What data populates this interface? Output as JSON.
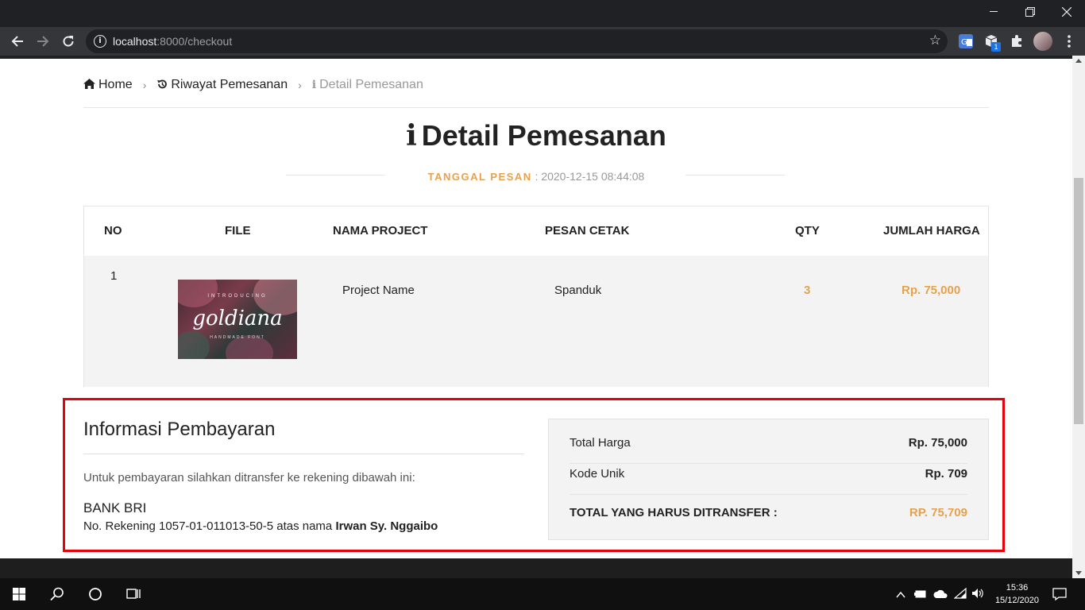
{
  "browser": {
    "url_host": "localhost",
    "url_path": ":8000/checkout",
    "extension_badge": "1"
  },
  "breadcrumb": {
    "home": "Home",
    "history": "Riwayat Pemesanan",
    "current": "Detail Pemesanan"
  },
  "page": {
    "title": "Detail Pemesanan",
    "date_label": "TANGGAL PESAN",
    "date_value": " : 2020-12-15 08:44:08"
  },
  "table": {
    "headers": [
      "NO",
      "FILE",
      "NAMA PROJECT",
      "PESAN CETAK",
      "QTY",
      "JUMLAH HARGA"
    ],
    "rows": [
      {
        "no": "1",
        "file_image_text_top": "INTRODUCING",
        "file_image_text_main": "goldiana",
        "file_image_text_bottom": "HANDMADE FONT",
        "project": "Project Name",
        "print": "Spanduk",
        "qty": "3",
        "price": "Rp. 75,000"
      }
    ]
  },
  "payment": {
    "title": "Informasi Pembayaran",
    "description": "Untuk pembayaran silahkan ditransfer ke rekening dibawah ini:",
    "bank": "BANK BRI",
    "account_prefix": "No. Rekening 1057-01-011013-50-5 atas nama ",
    "account_name": "Irwan Sy. Nggaibo"
  },
  "summary": {
    "total_label": "Total Harga",
    "total_value": "Rp. 75,000",
    "code_label": "Kode Unik",
    "code_value": "Rp. 709",
    "transfer_label": "TOTAL YANG HARUS DITRANSFER :",
    "transfer_value": "RP. 75,709"
  },
  "taskbar": {
    "time": "15:36",
    "date": "15/12/2020"
  },
  "colors": {
    "accent": "#e7a14b",
    "highlight_border": "#e8000a"
  }
}
